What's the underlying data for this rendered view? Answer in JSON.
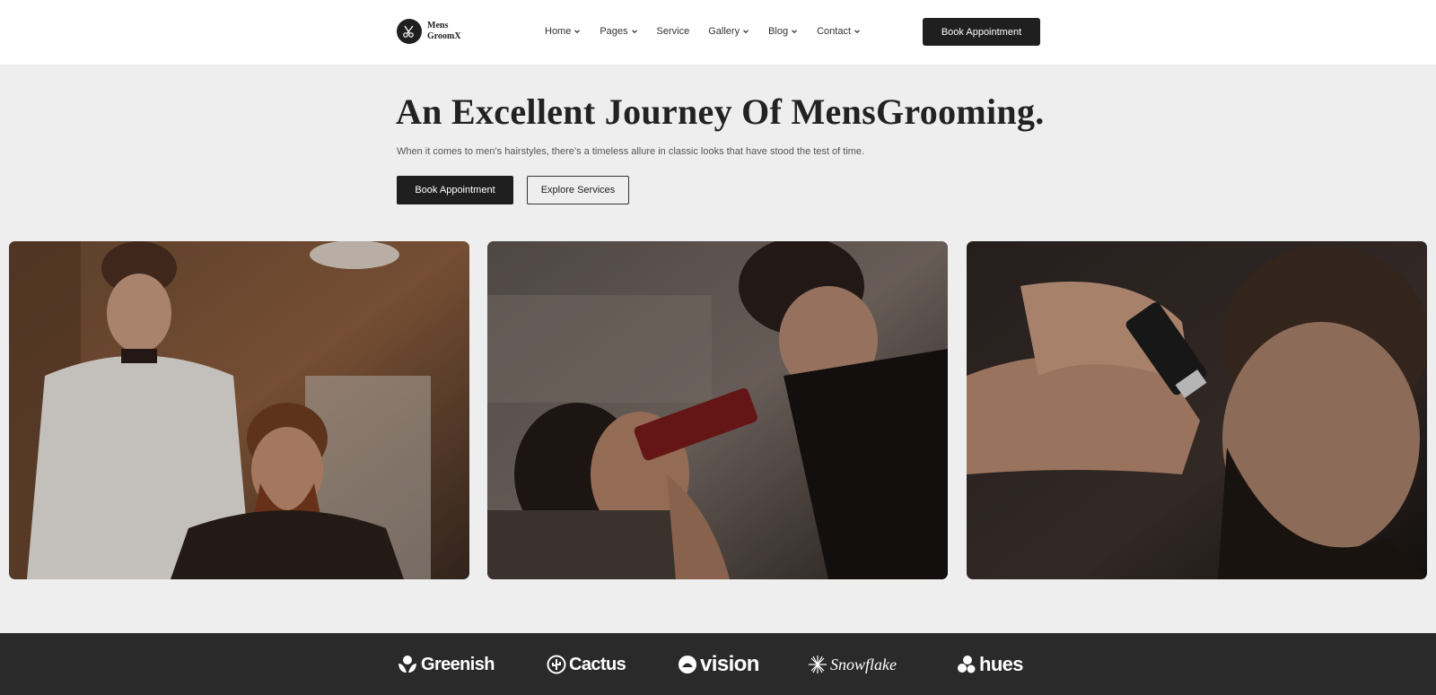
{
  "header": {
    "logo_line1": "Mens",
    "logo_line2": "GroomX",
    "nav": [
      {
        "label": "Home",
        "has_dropdown": true
      },
      {
        "label": "Pages",
        "has_dropdown": true
      },
      {
        "label": "Service",
        "has_dropdown": false
      },
      {
        "label": "Gallery",
        "has_dropdown": true
      },
      {
        "label": "Blog",
        "has_dropdown": true
      },
      {
        "label": "Contact",
        "has_dropdown": true
      }
    ],
    "cta_label": "Book Appointment"
  },
  "hero": {
    "title": "An Excellent Journey Of MensGrooming.",
    "subtitle": "When it comes to men’s hairstyles, there’s a timeless allure in classic looks that have stood the test of time.",
    "primary_btn": "Book Appointment",
    "secondary_btn": "Explore Services"
  },
  "gallery": [
    {
      "alt": "barber-cutting-hair-photo"
    },
    {
      "alt": "beard-trim-photo"
    },
    {
      "alt": "clipper-fade-photo"
    }
  ],
  "brands": [
    {
      "name": "Greenish",
      "icon": "leaf-icon"
    },
    {
      "name": "Cactus",
      "icon": "cactus-icon"
    },
    {
      "name": "vision",
      "icon": "vision-icon"
    },
    {
      "name": "Snowflake",
      "icon": "snowflake-icon"
    },
    {
      "name": "hues",
      "icon": "hues-icon"
    }
  ],
  "colors": {
    "page_bg": "#eeeeee",
    "header_bg": "#ffffff",
    "dark": "#1f1f1f",
    "brand_strip": "#2a2a2a"
  }
}
